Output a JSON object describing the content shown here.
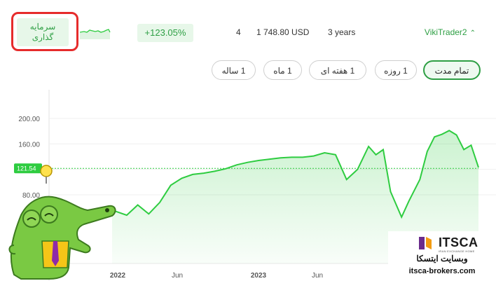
{
  "header": {
    "invest_label_line1": "سرمایه",
    "invest_label_line2": "گذاری",
    "return_pct": "+123.05%",
    "count": "4",
    "balance": "1 748.80 USD",
    "age": "3 years",
    "trader_name": "VikiTrader2"
  },
  "periods": [
    {
      "label": "تمام مدت",
      "active": true
    },
    {
      "label": "1 روزه",
      "active": false
    },
    {
      "label": "1 هفته ای",
      "active": false
    },
    {
      "label": "1 ماه",
      "active": false
    },
    {
      "label": "1 ساله",
      "active": false
    }
  ],
  "chart_data": {
    "type": "area",
    "y_ticks": [
      "200.00",
      "160.00",
      "120.00",
      "80.00"
    ],
    "x_ticks": [
      "2022",
      "Jun",
      "2023",
      "Jun"
    ],
    "current_value": "121.54",
    "ylim": [
      40,
      200
    ],
    "color": "#2ecc40",
    "x": [
      0,
      0.04,
      0.07,
      0.1,
      0.13,
      0.16,
      0.19,
      0.22,
      0.25,
      0.28,
      0.31,
      0.34,
      0.37,
      0.4,
      0.43,
      0.46,
      0.49,
      0.52,
      0.55,
      0.58,
      0.61,
      0.64,
      0.67,
      0.7,
      0.72,
      0.74,
      0.76,
      0.79,
      0.81,
      0.84,
      0.86,
      0.88,
      0.9,
      0.92,
      0.94,
      0.96,
      0.98,
      1.0
    ],
    "values": [
      56,
      48,
      64,
      50,
      68,
      95,
      106,
      112,
      114,
      117,
      121,
      127,
      131,
      134,
      136,
      138,
      139,
      139,
      141,
      146,
      143,
      104,
      120,
      156,
      143,
      151,
      85,
      45,
      70,
      104,
      148,
      171,
      175,
      181,
      174,
      151,
      158,
      123
    ]
  },
  "watermark": {
    "brand": "ITSCA",
    "tagline": "IRAN EXCHANGE HOME",
    "fa_text": "وبسایت ایتسکا",
    "url": "itsca-brokers.com"
  },
  "colors": {
    "accent": "#2e9f44",
    "highlight_frame": "#e62b2b",
    "line": "#2ecc40"
  }
}
